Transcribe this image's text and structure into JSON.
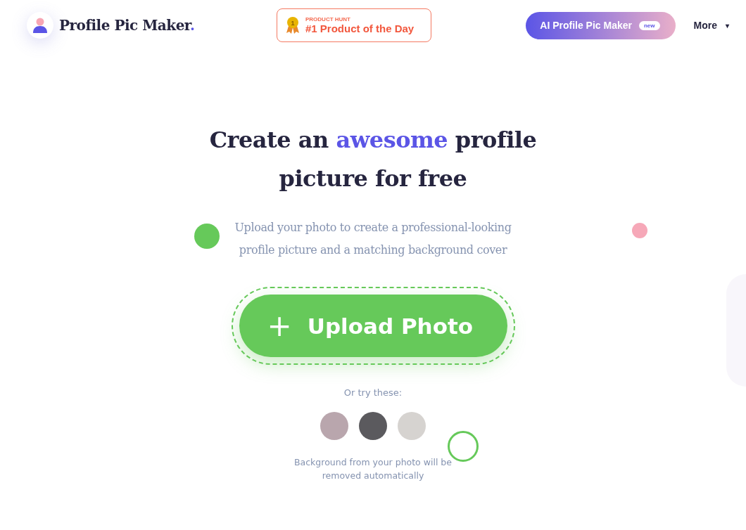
{
  "header": {
    "logo_text": "Profile Pic Maker",
    "logo_dot": ".",
    "badge": {
      "eyebrow": "PRODUCT HUNT",
      "title": "#1 Product of the Day",
      "medal": "1"
    },
    "ai_button": {
      "label": "AI Profile Pic Maker",
      "tag": "new"
    },
    "more": {
      "label": "More",
      "caret": "▾"
    }
  },
  "hero": {
    "headline": "Create an *awesome* profile picture for free",
    "subtitle": "Upload your photo to create a professional-looking profile picture and a matching background cover",
    "upload_button": {
      "icon": "+",
      "label": "Upload Photo"
    },
    "try_label": "Or try these:",
    "note": "Background from your photo will be removed automatically"
  }
}
